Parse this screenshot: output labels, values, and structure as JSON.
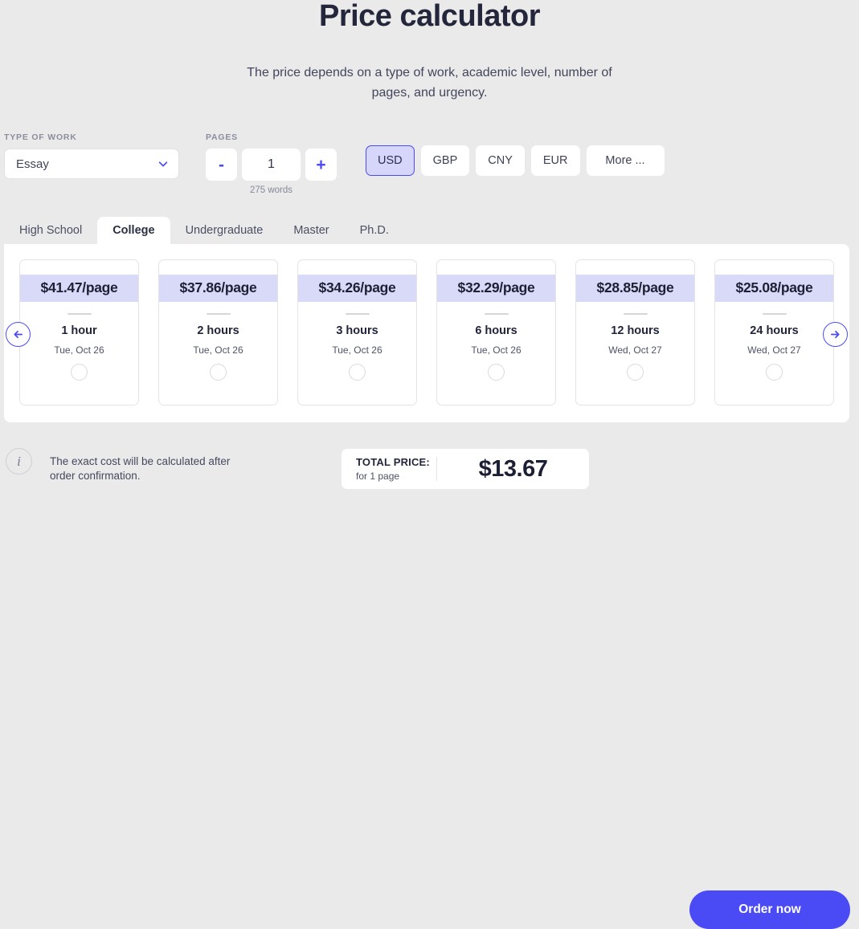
{
  "header": {
    "title": "Price calculator",
    "subtitle": "The price depends on a type of work, academic level, number of pages, and urgency."
  },
  "colors": {
    "accent": "#4b4bf5",
    "accent_soft": "#d9d9f8",
    "page_bg": "#eaeaea",
    "panel_bg": "#ffffff"
  },
  "type_of_work": {
    "label": "TYPE OF WORK",
    "value": "Essay",
    "icon": "chevron-down-icon"
  },
  "pages": {
    "label": "PAGES",
    "decrement": "-",
    "value": "1",
    "increment": "+",
    "words": "275 words"
  },
  "currencies": {
    "items": [
      {
        "label": "USD",
        "active": true
      },
      {
        "label": "GBP",
        "active": false
      },
      {
        "label": "CNY",
        "active": false
      },
      {
        "label": "EUR",
        "active": false
      },
      {
        "label": "More ...",
        "active": false
      }
    ]
  },
  "levels": {
    "tabs": [
      {
        "label": "High School",
        "active": false
      },
      {
        "label": "College",
        "active": true
      },
      {
        "label": "Undergraduate",
        "active": false
      },
      {
        "label": "Master",
        "active": false
      },
      {
        "label": "Ph.D.",
        "active": false
      }
    ]
  },
  "deadlines": {
    "prev_icon": "arrow-left-icon",
    "next_icon": "arrow-right-icon",
    "cards": [
      {
        "price": "$41.47/page",
        "hours": "1 hour",
        "date": "Tue, Oct 26",
        "selected": false
      },
      {
        "price": "$37.86/page",
        "hours": "2 hours",
        "date": "Tue, Oct 26",
        "selected": false
      },
      {
        "price": "$34.26/page",
        "hours": "3 hours",
        "date": "Tue, Oct 26",
        "selected": false
      },
      {
        "price": "$32.29/page",
        "hours": "6 hours",
        "date": "Tue, Oct 26",
        "selected": false
      },
      {
        "price": "$28.85/page",
        "hours": "12 hours",
        "date": "Wed, Oct 27",
        "selected": false
      },
      {
        "price": "$25.08/page",
        "hours": "24 hours",
        "date": "Wed, Oct 27",
        "selected": false
      }
    ]
  },
  "footer": {
    "info_icon": "info-icon",
    "note": "The exact cost will be calculated after order confirmation.",
    "total_label": "TOTAL PRICE:",
    "total_sub": "for 1 page",
    "total_amount": "$13.67",
    "order_button": "Order now"
  }
}
